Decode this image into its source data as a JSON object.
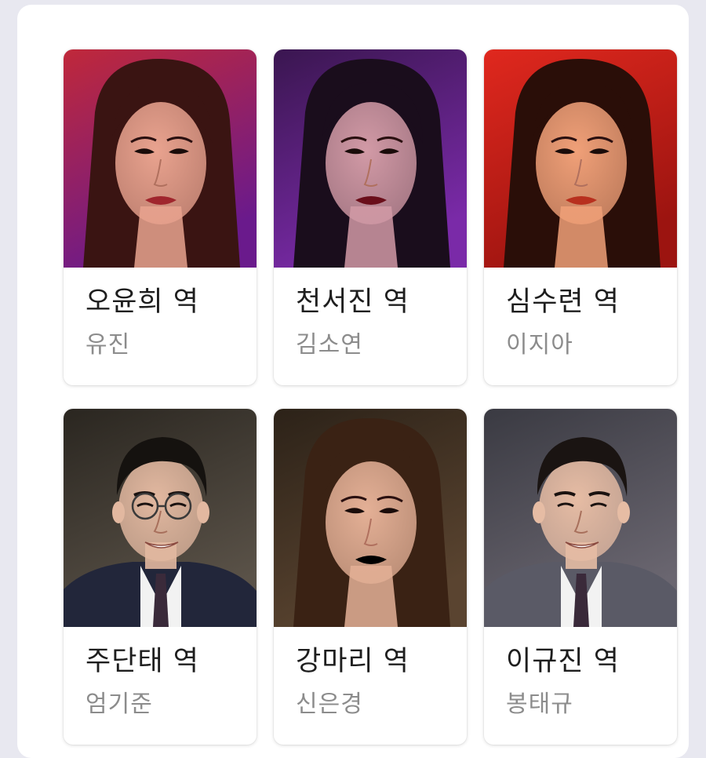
{
  "cast": [
    {
      "role": "오윤희 역",
      "actor": "유진",
      "photo_icon": "portrait-woman-red",
      "bg_top": "#c0283a",
      "bg_bottom": "#6a1a8c",
      "hair": "#3a1412",
      "skin": "#e9a38f",
      "lips": "#a0262d"
    },
    {
      "role": "천서진 역",
      "actor": "김소연",
      "photo_icon": "portrait-woman-purple",
      "bg_top": "#3a1650",
      "bg_bottom": "#7a2aa8",
      "hair": "#1a0d1c",
      "skin": "#d29aa6",
      "lips": "#6a0e1a"
    },
    {
      "role": "심수련 역",
      "actor": "이지아",
      "photo_icon": "portrait-woman-orange",
      "bg_top": "#e0281e",
      "bg_bottom": "#9c1410",
      "hair": "#2a0e08",
      "skin": "#f0a078",
      "lips": "#b8301e"
    },
    {
      "role": "주단태 역",
      "actor": "엄기준",
      "photo_icon": "portrait-man-glasses",
      "bg_top": "#2a2620",
      "bg_bottom": "#5a5248",
      "hair": "#15120f",
      "skin": "#e2b8a0",
      "suit": "#22263a"
    },
    {
      "role": "강마리 역",
      "actor": "신은경",
      "photo_icon": "portrait-woman-smiling",
      "bg_top": "#2c2218",
      "bg_bottom": "#5a4430",
      "hair": "#3a2214",
      "skin": "#e4b096",
      "suit": "#4a3620"
    },
    {
      "role": "이규진 역",
      "actor": "봉태규",
      "photo_icon": "portrait-man-smiling",
      "bg_top": "#3a3a42",
      "bg_bottom": "#6a6670",
      "hair": "#1a1412",
      "skin": "#e6bca4",
      "suit": "#5a5a66"
    }
  ]
}
